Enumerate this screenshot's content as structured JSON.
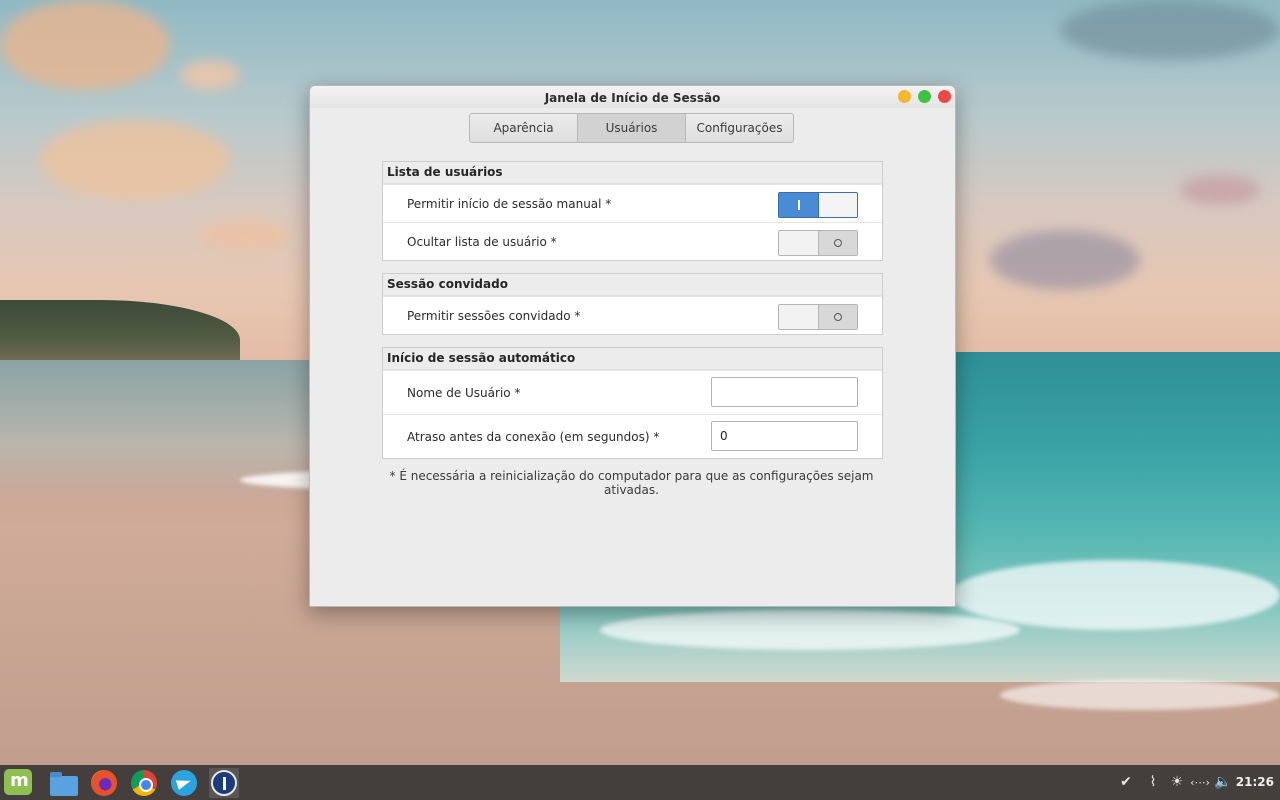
{
  "window": {
    "title": "Janela de Início de Sessão"
  },
  "tabs": [
    {
      "label": "Aparência"
    },
    {
      "label": "Usuários"
    },
    {
      "label": "Configurações"
    }
  ],
  "sections": {
    "user_list": {
      "heading": "Lista de usuários",
      "manual_login_label": "Permitir início de sessão manual *",
      "manual_login_on": true,
      "hide_list_label": "Ocultar lista de usuário *",
      "hide_list_on": false
    },
    "guest": {
      "heading": "Sessão convidado",
      "allow_guest_label": "Permitir sessões convidado *",
      "allow_guest_on": false
    },
    "autologin": {
      "heading": "Início de sessão automático",
      "username_label": "Nome de Usuário *",
      "username_value": "",
      "delay_label": "Atraso antes da conexão (em segundos) *",
      "delay_value": "0"
    }
  },
  "note": "* É necessária a reinicialização do computador para que as configurações sejam ativadas.",
  "taskbar": {
    "apps": [
      "mint-menu-icon",
      "files-icon",
      "firefox-icon",
      "chrome-icon",
      "telegram-icon",
      "password-manager-icon"
    ],
    "clock": "21:26"
  },
  "colors": {
    "switch_on": "#4a8bd6",
    "close": "#ee4845",
    "minimize": "#f4b72e",
    "maximize": "#3ec242"
  }
}
